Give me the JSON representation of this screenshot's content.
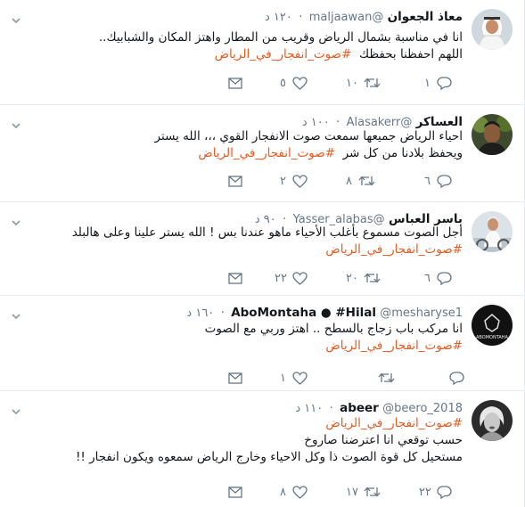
{
  "tweets": [
    {
      "name": "معاذ الجعوان",
      "handle": "@maljaawan",
      "time": "١٢٠ د",
      "lines": [
        {
          "text": "انا في مناسبة بشمال الرياض وقريب من المطار واهتز المكان والشبابيك..",
          "hashtag": ""
        },
        {
          "text": "اللهم احفظنا بحفظك",
          "hashtag": "#صوت_انفجار_في_الرياض"
        }
      ],
      "reply_count": "١",
      "retweet_count": "١٠",
      "like_count": "٥",
      "avatar": "man-with-shemagh-avatar"
    },
    {
      "name": "العساكر",
      "handle": "@Alasakerr",
      "time": "١٠٠ د",
      "lines": [
        {
          "text": "احياء الرياض جميعها سمعت صوت الانفجار القوي ،،، الله يستر",
          "hashtag": ""
        },
        {
          "text": "ويحفظ بلادنا من كل شر",
          "hashtag": "#صوت_انفجار_في_الرياض"
        }
      ],
      "reply_count": "٦",
      "retweet_count": "٨",
      "like_count": "٢",
      "avatar": "man-portrait-avatar"
    },
    {
      "name": "باسر العباس",
      "handle": "@Yasser_alabas",
      "time": "٩٠ د",
      "lines": [
        {
          "text": "أجل الصوت مسموع بأغلب الأحياء ماهو عندنا بس ! الله يستر علينا وعلى هالبلد",
          "hashtag": ""
        },
        {
          "text": "",
          "hashtag": "#صوت_انفجار_في_الرياض"
        }
      ],
      "reply_count": "٦",
      "retweet_count": "٢٠",
      "like_count": "٢٢",
      "avatar": "man-on-bike-avatar"
    },
    {
      "name": "AboMontaha ● #Hilal",
      "handle": "@mesharyse1",
      "time": "١٦٠ د",
      "lines": [
        {
          "text": "انا مركب باب زجاج بالسطح .. اهتز وربي مع الصوت",
          "hashtag": ""
        },
        {
          "text": "",
          "hashtag": "#صوت_انفجار_في_الرياض"
        }
      ],
      "reply_count": "",
      "retweet_count": "",
      "like_count": "١",
      "avatar": "abomontaha-logo-avatar",
      "avatar_text": "ABOMONTAHA"
    },
    {
      "name": "abeer",
      "handle": "@beero_2018",
      "time": "١١٠ د",
      "lines": [
        {
          "text": "",
          "hashtag": "#صوت_انفجار_في_الرياض"
        },
        {
          "text": "حسب توقعي انا اعترضنا صاروخ",
          "hashtag": ""
        },
        {
          "text": "مستحيل كل قوة الصوت ذا وكل الاحياء وخارج الرياض سمعوه ويكون انفجار !!",
          "hashtag": ""
        }
      ],
      "reply_count": "٢٢",
      "retweet_count": "١٧",
      "like_count": "٨",
      "avatar": "woman-portrait-avatar"
    }
  ],
  "colors": {
    "hashtag": "#e35c24",
    "muted": "#657786",
    "divider": "#e6ecf0"
  }
}
